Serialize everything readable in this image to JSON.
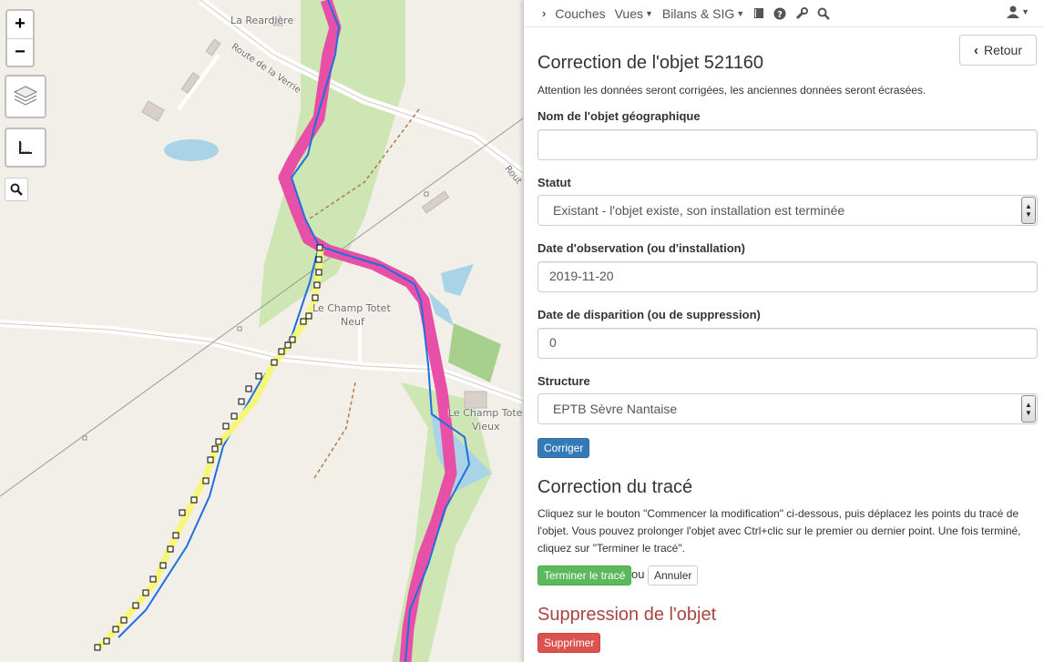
{
  "map": {
    "labels": [
      "La Reardière",
      "Route de la Verrie",
      "Le Champ Totet",
      "Neuf",
      "Le Champ Totet",
      "Vieux",
      "Rout"
    ],
    "zoom_in": "+",
    "zoom_out": "−",
    "colors": {
      "river": "#e84fa6",
      "edit_line": "#f6f67a",
      "blue_line": "#1f6fe0",
      "green": "#cbe5b1",
      "water": "#a9d3e6"
    }
  },
  "navbar": {
    "items": [
      {
        "label": "Couches",
        "icon": "chevron-right-icon"
      },
      {
        "label": "Vues",
        "icon": "caret-down-icon"
      },
      {
        "label": "Bilans & SIG",
        "icon": "caret-down-icon"
      }
    ],
    "icons": [
      "book-icon",
      "help-icon",
      "wrench-icon",
      "search-icon"
    ],
    "user_icon": "user-icon"
  },
  "panel": {
    "back_label": "Retour",
    "title": "Correction de l'objet 521160",
    "warning": "Attention les données seront corrigées, les anciennes données seront écrasées.",
    "fields": {
      "name_label": "Nom de l'objet géographique",
      "name_value": "",
      "status_label": "Statut",
      "status_value": "Existant - l'objet existe, son installation est terminée",
      "obs_date_label": "Date d'observation (ou d'installation)",
      "obs_date_value": "2019-11-20",
      "disp_date_label": "Date de disparition (ou de suppression)",
      "disp_date_value": "0",
      "structure_label": "Structure",
      "structure_value": "EPTB Sèvre Nantaise"
    },
    "correct_button": "Corriger",
    "trace_title": "Correction du tracé",
    "trace_text": "Cliquez sur le bouton \"Commencer la modification\" ci-dessous, puis déplacez les points du tracé de l'objet. Vous pouvez prolonger l'objet avec Ctrl+clic sur le premier ou dernier point. Une fois terminé, cliquez sur \"Terminer le tracé\".",
    "finish_button": "Terminer le tracé",
    "or_text": "ou",
    "cancel_button": "Annuler",
    "delete_title": "Suppression de l'objet",
    "delete_button": "Supprimer",
    "delete_color": "#a94442"
  }
}
